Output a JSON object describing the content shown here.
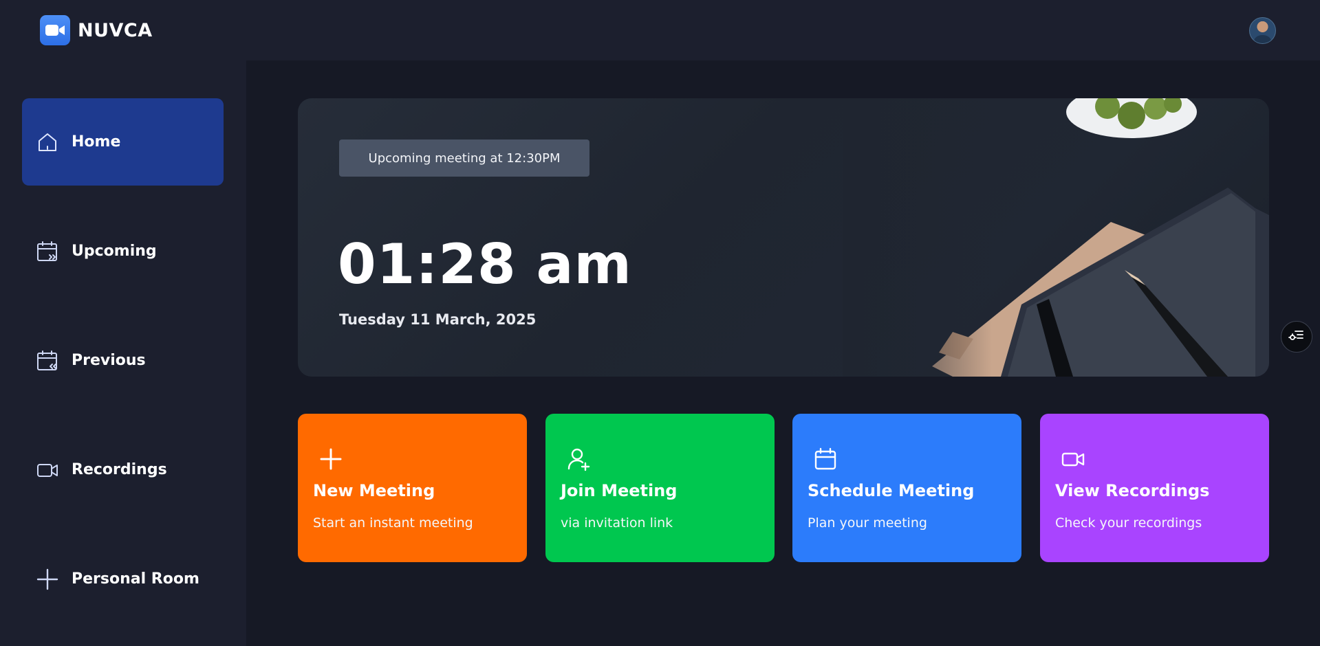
{
  "app": {
    "name": "NUVCA"
  },
  "header": {
    "avatar_icon": "user-avatar"
  },
  "sidebar": {
    "items": [
      {
        "label": "Home",
        "icon": "home-icon",
        "active": true
      },
      {
        "label": "Upcoming",
        "icon": "calendar-forward-icon",
        "active": false
      },
      {
        "label": "Previous",
        "icon": "calendar-back-icon",
        "active": false
      },
      {
        "label": "Recordings",
        "icon": "video-icon",
        "active": false
      },
      {
        "label": "Personal Room",
        "icon": "plus-icon",
        "active": false
      }
    ]
  },
  "hero": {
    "badge": "Upcoming meeting at 12:30PM",
    "time": "01:28 am",
    "date": "Tuesday 11 March, 2025"
  },
  "cards": [
    {
      "title": "New Meeting",
      "subtitle": "Start an instant meeting",
      "color": "#ff6a00",
      "icon": "plus-icon"
    },
    {
      "title": "Join Meeting",
      "subtitle": "via invitation link",
      "color": "#00c74f",
      "icon": "user-add-icon"
    },
    {
      "title": "Schedule Meeting",
      "subtitle": "Plan your meeting",
      "color": "#2c7cfb",
      "icon": "calendar-icon"
    },
    {
      "title": "View Recordings",
      "subtitle": "Check your recordings",
      "color": "#a944ff",
      "icon": "video-icon"
    }
  ],
  "colors": {
    "background": "#161925",
    "panel": "#1c1f2e",
    "active_nav": "#1e3a8f"
  }
}
